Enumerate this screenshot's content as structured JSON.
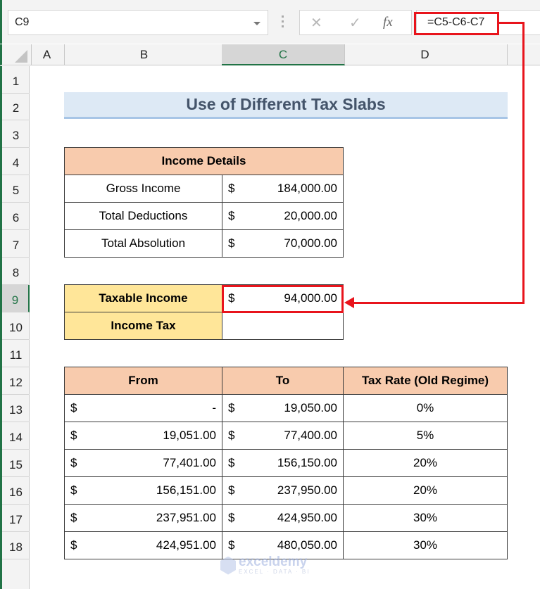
{
  "formula_bar": {
    "name_box": "C9",
    "cancel_icon": "✕",
    "enter_icon": "✓",
    "fx_label": "fx",
    "formula": "=C5-C6-C7"
  },
  "columns": [
    "A",
    "B",
    "C",
    "D"
  ],
  "selected_column": "C",
  "rows": [
    "1",
    "2",
    "3",
    "4",
    "5",
    "6",
    "7",
    "8",
    "9",
    "10",
    "11",
    "12",
    "13",
    "14",
    "15",
    "16",
    "17",
    "18"
  ],
  "selected_row": "9",
  "title": "Use of Different Tax Slabs",
  "income_details": {
    "header": "Income Details",
    "items": [
      {
        "label": "Gross Income",
        "currency": "$",
        "value": "184,000.00"
      },
      {
        "label": "Total Deductions",
        "currency": "$",
        "value": "20,000.00"
      },
      {
        "label": "Total Absolution",
        "currency": "$",
        "value": "70,000.00"
      }
    ]
  },
  "summary": {
    "taxable_income_label": "Taxable Income",
    "taxable_income_currency": "$",
    "taxable_income_value": "94,000.00",
    "income_tax_label": "Income Tax",
    "income_tax_value": ""
  },
  "slabs": {
    "headers": [
      "From",
      "To",
      "Tax Rate (Old Regime)"
    ],
    "rows": [
      {
        "from_cur": "$",
        "from": "-",
        "to_cur": "$",
        "to": "19,050.00",
        "rate": "0%"
      },
      {
        "from_cur": "$",
        "from": "19,051.00",
        "to_cur": "$",
        "to": "77,400.00",
        "rate": "5%"
      },
      {
        "from_cur": "$",
        "from": "77,401.00",
        "to_cur": "$",
        "to": "156,150.00",
        "rate": "20%"
      },
      {
        "from_cur": "$",
        "from": "156,151.00",
        "to_cur": "$",
        "to": "237,950.00",
        "rate": "20%"
      },
      {
        "from_cur": "$",
        "from": "237,951.00",
        "to_cur": "$",
        "to": "424,950.00",
        "rate": "30%"
      },
      {
        "from_cur": "$",
        "from": "424,951.00",
        "to_cur": "$",
        "to": "480,050.00",
        "rate": "30%"
      }
    ]
  },
  "watermark": {
    "name": "exceldemy",
    "tagline": "EXCEL · DATA · BI"
  }
}
